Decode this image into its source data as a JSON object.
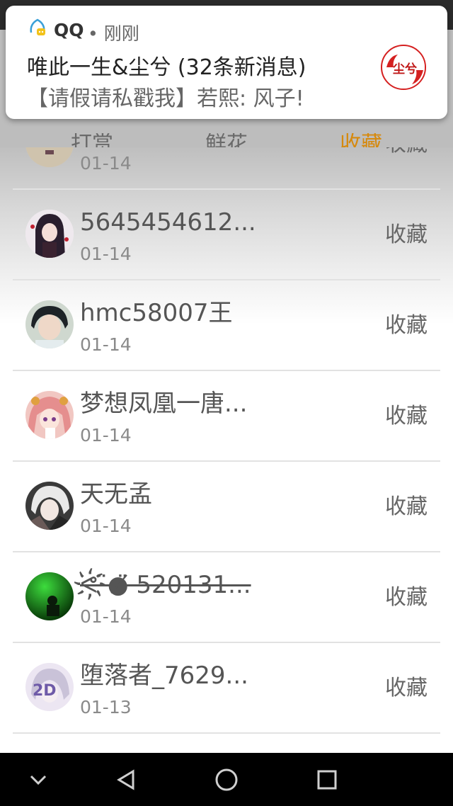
{
  "notification": {
    "app_name": "QQ",
    "time": "• 刚刚",
    "title": "唯此一生&尘兮 (32条新消息)",
    "message": "【请假请私戳我】若熙: 风子!",
    "logo_text": "尘兮"
  },
  "tabs": [
    {
      "label": "打赏",
      "active": false
    },
    {
      "label": "鲜花",
      "active": false
    },
    {
      "label": "收藏",
      "active": true
    }
  ],
  "list": {
    "items": [
      {
        "name": "",
        "date": "01-14",
        "action": "收藏",
        "avatar": "avatar-partial"
      },
      {
        "name": "5645454612...",
        "date": "01-14",
        "action": "收藏",
        "avatar": "anime-girl-dark"
      },
      {
        "name": "hmc58007王",
        "date": "01-14",
        "action": "收藏",
        "avatar": "boy-photo"
      },
      {
        "name": "梦想凤凰一唐...",
        "date": "01-14",
        "action": "收藏",
        "avatar": "anime-girl-pink"
      },
      {
        "name": "天无孟",
        "date": "01-14",
        "action": "收藏",
        "avatar": "anime-silver-hair"
      },
      {
        "name": "ᕙ҉̈●̸̈ 520131...",
        "date": "01-14",
        "action": "收藏",
        "avatar": "green-silhouette"
      },
      {
        "name": "堕落者_7629...",
        "date": "01-13",
        "action": "收藏",
        "avatar": "anime-2d"
      }
    ]
  },
  "nav": {
    "down": "chevron-down-icon",
    "back": "triangle-back-icon",
    "home": "circle-home-icon",
    "recent": "square-recent-icon"
  }
}
